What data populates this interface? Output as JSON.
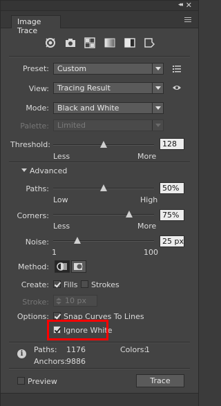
{
  "window": {
    "collapse_glyph": "◂◂",
    "close_glyph": "✕"
  },
  "tab": {
    "title": "Image Trace"
  },
  "presets_toolbar": [
    {
      "name": "auto-color",
      "icon": "auto-color-icon"
    },
    {
      "name": "high-color",
      "icon": "camera-icon"
    },
    {
      "name": "low-color",
      "icon": "grid-icon"
    },
    {
      "name": "grayscale",
      "icon": "grayscale-icon"
    },
    {
      "name": "black-and-white",
      "icon": "half-square-icon"
    },
    {
      "name": "outline",
      "icon": "outline-icon"
    }
  ],
  "preset": {
    "label": "Preset:",
    "value": "Custom"
  },
  "view": {
    "label": "View:",
    "value": "Tracing Result"
  },
  "mode": {
    "label": "Mode:",
    "value": "Black and White"
  },
  "palette": {
    "label": "Palette:",
    "value": "Limited"
  },
  "threshold": {
    "label": "Threshold:",
    "value": "128",
    "level": 128,
    "min": 0,
    "max": 255,
    "min_label": "Less",
    "max_label": "More"
  },
  "advanced": {
    "label": "Advanced"
  },
  "paths": {
    "label": "Paths:",
    "value": "50%",
    "level": 50,
    "min_label": "Low",
    "max_label": "High"
  },
  "corners": {
    "label": "Corners:",
    "value": "75%",
    "level": 75,
    "min_label": "Less",
    "max_label": "More"
  },
  "noise": {
    "label": "Noise:",
    "value": "25 px",
    "level": 25,
    "min": 1,
    "max": 100,
    "min_label": "1",
    "max_label": "100"
  },
  "method": {
    "label": "Method:"
  },
  "create": {
    "label": "Create:",
    "fills_label": "Fills",
    "fills_checked": true,
    "strokes_label": "Strokes",
    "strokes_checked": false
  },
  "stroke": {
    "label": "Stroke:",
    "value": "10 px"
  },
  "options": {
    "label": "Options:",
    "snap_label": "Snap Curves To Lines",
    "snap_checked": true,
    "ignore_white_label": "Ignore White",
    "ignore_white_checked": true
  },
  "stats": {
    "paths_label": "Paths:",
    "paths_value": "1176",
    "colors_label": "Colors:",
    "colors_value": "1",
    "anchors_label": "Anchors:",
    "anchors_value": "9886"
  },
  "footer": {
    "preview_label": "Preview",
    "preview_checked": false,
    "trace_label": "Trace"
  },
  "colors": {
    "panel_bg": "#434343",
    "highlight": "#ff0000"
  }
}
